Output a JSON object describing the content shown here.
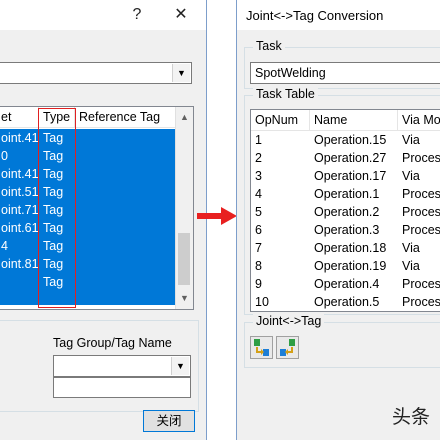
{
  "left_dialog": {
    "help_symbol": "?",
    "close_symbol": "✕",
    "columns": [
      "et",
      "Type",
      "Reference Tag"
    ],
    "rows": [
      {
        "name": "oint.41",
        "type": "Tag",
        "ref": ""
      },
      {
        "name": "0",
        "type": "Tag",
        "ref": ""
      },
      {
        "name": "oint.41",
        "type": "Tag",
        "ref": ""
      },
      {
        "name": "oint.51",
        "type": "Tag",
        "ref": ""
      },
      {
        "name": "oint.71",
        "type": "Tag",
        "ref": ""
      },
      {
        "name": "oint.61",
        "type": "Tag",
        "ref": ""
      },
      {
        "name": "4",
        "type": "Tag",
        "ref": ""
      },
      {
        "name": "oint.81",
        "type": "Tag",
        "ref": ""
      },
      {
        "name": "",
        "type": "Tag",
        "ref": ""
      }
    ],
    "tag_group_label": "Tag Group/Tag Name",
    "tag_group_value": "",
    "tag_name_value": "",
    "close_button": "关闭"
  },
  "right_dialog": {
    "title": "Joint<->Tag Conversion",
    "task_label": "Task",
    "task_value": "SpotWelding",
    "task_table_label": "Task Table",
    "columns": [
      "OpNum",
      "Name",
      "Via Mo"
    ],
    "rows": [
      {
        "num": "1",
        "name": "Operation.15",
        "via": "Via"
      },
      {
        "num": "2",
        "name": "Operation.27",
        "via": "Proces"
      },
      {
        "num": "3",
        "name": "Operation.17",
        "via": "Via"
      },
      {
        "num": "4",
        "name": "Operation.1",
        "via": "Proces"
      },
      {
        "num": "5",
        "name": "Operation.2",
        "via": "Proces"
      },
      {
        "num": "6",
        "name": "Operation.3",
        "via": "Proces"
      },
      {
        "num": "7",
        "name": "Operation.18",
        "via": "Via"
      },
      {
        "num": "8",
        "name": "Operation.19",
        "via": "Via"
      },
      {
        "num": "9",
        "name": "Operation.4",
        "via": "Proces"
      },
      {
        "num": "10",
        "name": "Operation.5",
        "via": "Proces"
      }
    ],
    "joint_tag_label": "Joint<->Tag",
    "icons": [
      "joint-to-tag-icon",
      "tag-to-joint-icon"
    ]
  },
  "watermark": "头条",
  "colors": {
    "selection": "#0078d7",
    "highlight_box": "#e02020",
    "arrow": "#e82020"
  }
}
